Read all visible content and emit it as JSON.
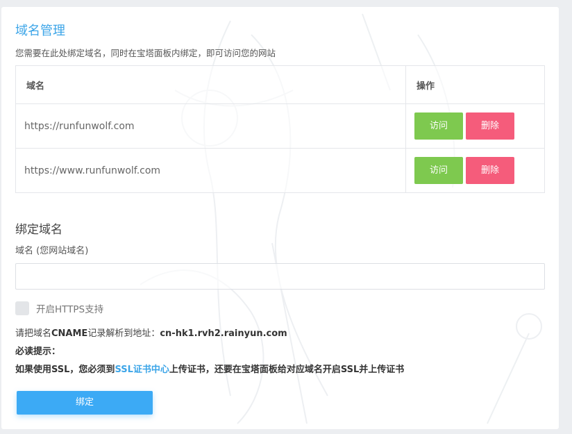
{
  "header": {
    "title": "域名管理",
    "description": "您需要在此处绑定域名，同时在宝塔面板内绑定，即可访问您的网站"
  },
  "table": {
    "columns": [
      "域名",
      "操作"
    ],
    "rows": [
      {
        "domain": "https://runfunwolf.com",
        "visit_label": "访问",
        "delete_label": "删除"
      },
      {
        "domain": "https://www.runfunwolf.com",
        "visit_label": "访问",
        "delete_label": "删除"
      }
    ]
  },
  "bind": {
    "section_title": "绑定域名",
    "field_label": "域名 (您网站域名)",
    "input_value": "",
    "input_placeholder": "",
    "https_label": "开启HTTPS支持",
    "https_checked": false,
    "cname_prefix": "请把域名",
    "cname_bold": "CNAME",
    "cname_middle": "记录解析到地址：",
    "cname_target": "cn-hk1.rvh2.rainyun.com",
    "tip_title": "必读提示：",
    "tip_part1": "如果使用SSL，您必须到",
    "tip_link": "SSL证书中心",
    "tip_part2": "上传证书，还要在宝塔面板给对应域名开启SSL并上传证书",
    "button_label": "绑定"
  },
  "colors": {
    "accent": "#3ca5e8",
    "visit": "#7ec94f",
    "delete": "#f55c7b",
    "primary_button": "#3caaf5"
  }
}
